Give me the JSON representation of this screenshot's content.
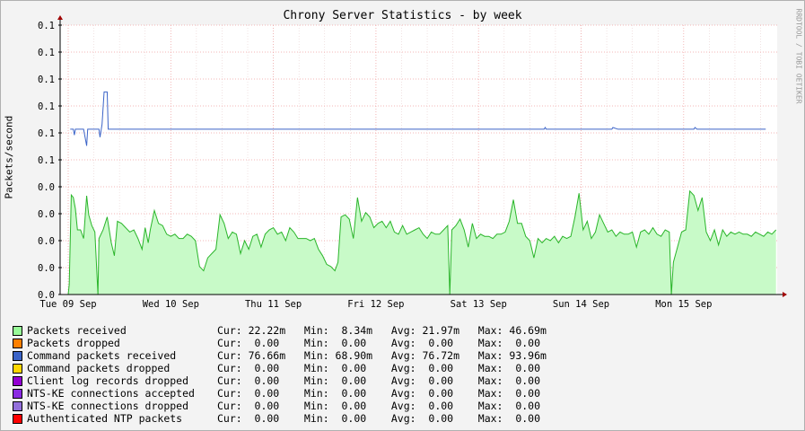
{
  "title": "Chrony Server Statistics - by week",
  "watermark": "RRDTOOL / TOBI OETIKER",
  "chart_data": {
    "type": "area",
    "title": "Chrony Server Statistics - by week",
    "ylabel": "Packets/second",
    "ytick_labels": [
      "0.0",
      "0.0",
      "0.0",
      "0.0",
      "0.0",
      "0.1",
      "0.1",
      "0.1",
      "0.1",
      "0.1",
      "0.1"
    ],
    "ytick_values": [
      0.0,
      0.0125,
      0.025,
      0.0375,
      0.05,
      0.0625,
      0.075,
      0.0875,
      0.1,
      0.1125,
      0.125
    ],
    "ylim": [
      0,
      0.125
    ],
    "xlim_days": [
      0,
      7
    ],
    "xtick_labels": [
      "Tue 09 Sep",
      "Wed 10 Sep",
      "Thu 11 Sep",
      "Fri 12 Sep",
      "Sat 13 Sep",
      "Sun 14 Sep",
      "Mon 15 Sep"
    ],
    "grid": true,
    "series": [
      {
        "name": "Packets received",
        "color": "#98fb98",
        "line_color": "#2ab52a",
        "x_days": [
          -0.28,
          -0.27,
          -0.25,
          -0.23,
          -0.22,
          -0.21,
          -0.2,
          -0.18,
          -0.17,
          -0.16,
          -0.14,
          -0.13,
          -0.12,
          -0.1,
          -0.09,
          -0.08,
          -0.06,
          -0.05,
          -0.04,
          -0.02,
          0.0,
          0.02,
          0.04,
          0.05,
          0.07,
          0.09,
          0.1,
          0.12,
          0.14,
          0.16,
          0.18,
          0.2,
          0.22,
          0.24,
          0.26,
          0.28,
          0.3,
          0.32,
          0.34,
          0.36,
          0.38,
          0.4,
          0.42,
          0.44,
          0.46,
          0.48,
          0.5,
          0.52,
          0.54,
          0.56,
          0.58,
          0.6,
          0.62,
          0.64,
          0.66,
          0.68,
          0.7,
          0.72,
          0.74,
          0.76,
          0.78,
          0.8,
          0.82,
          0.84,
          0.86,
          0.88,
          0.9,
          0.92,
          0.94,
          0.96,
          0.98,
          1.0,
          1.02,
          1.04,
          1.06,
          1.08,
          1.1,
          1.12,
          1.14,
          1.16,
          1.18,
          1.2,
          1.22,
          1.24,
          1.26,
          1.28,
          1.3,
          1.32,
          1.34,
          1.36,
          1.38,
          1.4,
          1.42,
          1.44,
          1.46,
          1.48,
          1.5,
          1.52,
          1.54,
          1.56,
          1.58,
          1.6,
          1.62,
          1.64,
          1.66,
          1.68,
          1.7,
          1.72,
          1.74,
          1.76,
          1.78,
          1.8,
          1.82,
          1.84,
          1.86,
          1.88,
          1.9,
          1.92,
          1.94,
          1.96,
          1.98,
          2.0,
          2.02,
          2.04,
          2.06,
          2.08,
          2.1,
          2.12,
          2.14,
          2.16,
          2.18,
          2.2,
          2.22,
          2.24,
          2.26,
          2.28,
          2.3,
          2.32,
          2.34,
          2.36,
          2.38,
          2.4,
          2.42,
          2.44,
          2.46,
          2.48,
          2.5,
          2.52,
          2.54,
          2.56,
          2.58,
          2.6,
          2.62,
          2.64,
          2.66,
          2.68,
          2.7,
          2.72,
          2.74,
          2.76,
          2.78,
          2.8,
          2.82,
          2.84,
          2.86,
          2.88,
          2.9,
          2.92,
          2.94,
          2.96,
          2.98,
          3.0,
          3.02,
          3.04,
          3.06,
          3.08,
          3.1,
          3.12,
          3.14,
          3.16,
          3.18,
          3.2,
          3.22,
          3.24,
          3.26,
          3.28,
          3.3,
          3.32,
          3.34,
          3.36,
          3.38,
          3.4,
          3.42,
          3.44,
          3.46,
          3.48,
          3.5,
          3.52,
          3.54,
          3.56,
          3.58,
          3.6,
          3.62,
          3.64,
          3.66,
          3.68,
          3.7,
          3.72,
          3.74,
          3.76,
          3.78,
          3.8,
          3.82,
          3.84,
          3.86,
          3.88,
          3.9,
          3.92,
          3.94,
          3.96,
          3.98,
          4.0,
          4.02,
          4.04,
          4.06,
          4.08,
          4.1,
          4.12,
          4.14,
          4.16,
          4.18,
          4.2,
          4.22,
          4.24,
          4.26,
          4.28,
          4.3,
          4.32,
          4.34,
          4.36,
          4.38,
          4.4,
          4.42,
          4.44,
          4.46,
          4.48,
          4.5,
          4.52,
          4.54,
          4.56,
          4.58,
          4.6,
          4.62,
          4.64,
          4.66,
          4.68,
          4.7,
          4.72,
          4.74,
          4.76,
          4.78,
          4.8,
          4.82,
          4.84,
          4.86,
          4.88,
          4.9,
          4.92,
          4.94,
          4.96,
          4.98,
          5.0,
          5.02,
          5.04,
          5.06,
          5.08,
          5.1,
          5.12,
          5.14,
          5.16,
          5.18,
          5.2,
          5.22,
          5.24,
          5.26,
          5.28,
          5.3,
          5.32,
          5.34,
          5.36,
          5.38,
          5.4,
          5.42,
          5.44,
          5.46,
          5.48,
          5.5,
          5.52,
          5.54,
          5.56,
          5.58,
          5.6,
          5.62,
          5.64,
          5.66,
          5.68,
          5.7,
          5.72,
          5.74,
          5.76,
          5.78,
          5.8,
          5.82,
          5.84,
          5.86,
          5.88,
          5.9,
          5.92,
          5.94,
          5.96,
          5.98,
          6.0,
          6.02,
          6.04,
          6.06,
          6.08,
          6.1,
          6.12,
          6.14,
          6.16,
          6.18,
          6.2,
          6.22,
          6.24,
          6.26,
          6.28,
          6.3,
          6.32,
          6.34,
          6.36,
          6.38,
          6.4,
          6.42,
          6.44,
          6.46,
          6.48,
          6.5,
          6.52,
          6.54,
          6.56,
          6.58,
          6.6,
          6.62,
          6.64,
          6.66,
          6.68,
          6.7,
          6.72,
          6.74,
          6.76,
          6.78,
          6.8,
          6.82,
          6.84,
          6.86,
          6.88,
          6.9,
          6.92,
          6.94,
          6.96,
          6.98,
          7.0,
          7.02,
          7.04,
          7.06,
          7.08,
          7.1,
          7.12,
          7.14,
          7.16,
          7.18,
          7.2,
          7.22,
          7.24,
          7.26,
          7.28,
          7.3,
          7.32,
          7.34,
          7.36,
          7.38,
          7.4,
          7.42,
          7.44,
          7.46,
          7.48,
          7.5,
          7.52,
          7.54,
          7.56,
          7.58,
          7.6,
          7.62,
          7.64,
          7.66,
          7.68,
          7.7,
          7.72,
          7.74,
          7.76,
          7.78,
          7.8,
          7.82,
          7.84,
          7.86,
          7.88,
          7.9,
          7.92,
          7.94,
          7.96,
          7.98,
          8.0,
          8.02,
          8.04,
          8.06,
          8.08,
          8.1,
          8.12,
          8.14,
          8.16,
          8.18,
          8.2,
          8.22,
          8.24,
          8.26,
          8.28,
          8.3,
          8.32,
          8.34,
          8.36,
          8.38,
          8.4,
          8.42,
          8.44,
          8.46,
          8.48,
          8.5,
          8.52,
          8.54,
          8.56,
          8.58,
          8.6,
          8.62,
          8.64,
          8.66,
          8.68,
          8.7,
          8.72,
          8.74,
          8.76,
          8.78,
          8.8,
          8.82,
          8.84,
          8.86,
          8.88,
          8.9,
          8.92,
          8.94,
          8.96,
          8.98,
          9.0,
          9.02,
          9.04,
          9.06,
          9.08,
          9.1,
          9.12,
          9.14,
          9.16,
          9.18,
          9.2,
          9.22,
          9.24,
          9.26,
          9.28,
          9.3,
          9.32,
          9.34,
          9.36,
          9.38,
          9.4,
          9.42,
          9.44,
          9.46,
          9.48,
          9.5,
          9.52,
          9.54,
          9.56,
          9.58,
          9.6,
          9.62,
          9.64,
          9.66,
          9.68,
          9.7,
          9.72,
          9.74,
          9.76,
          9.78,
          9.8,
          9.82,
          9.84,
          9.86,
          9.88,
          9.9,
          9.92,
          9.94,
          9.96,
          9.98,
          10.0,
          10.02,
          10.04,
          10.06,
          10.08,
          10.1,
          10.12,
          10.14,
          10.16,
          10.18,
          10.2,
          10.22,
          10.24,
          10.26,
          10.28,
          10.3,
          10.32,
          10.34,
          10.36,
          10.38,
          10.4,
          10.42,
          10.44,
          10.46,
          10.48,
          10.5,
          10.52,
          10.54,
          10.56,
          10.58,
          10.6,
          10.62,
          10.64,
          10.66,
          10.68,
          10.7,
          10.72,
          10.74,
          10.76,
          10.78,
          10.8,
          10.82,
          10.84,
          10.86,
          10.88,
          10.9,
          10.92,
          10.94,
          10.96,
          10.98,
          11.0,
          11.02,
          11.04,
          11.06,
          11.08,
          11.1,
          11.12,
          11.14,
          11.16,
          11.18,
          11.2,
          11.22,
          11.24,
          11.26,
          11.28,
          11.3,
          11.32,
          11.34,
          11.36,
          11.38,
          11.4,
          11.42,
          11.44,
          11.46,
          11.48,
          11.5,
          11.52,
          11.54,
          11.56,
          11.58,
          11.6,
          11.62,
          11.64,
          11.66,
          11.68,
          11.7,
          11.72,
          11.74,
          11.76,
          11.78,
          11.8,
          11.82,
          11.84,
          11.86,
          11.88,
          11.9,
          11.92,
          11.94,
          11.96,
          11.98,
          12.0,
          12.02,
          12.04,
          12.06,
          12.08,
          12.1,
          12.12,
          12.14,
          12.16,
          12.18,
          12.2,
          12.22,
          12.24,
          12.26,
          12.28,
          12.3,
          12.32,
          12.34,
          12.36,
          12.38,
          12.4,
          12.42,
          12.44,
          12.46,
          12.48,
          12.5,
          12.52,
          12.54,
          12.56,
          12.58,
          12.6,
          12.62,
          12.64,
          12.66,
          12.68,
          12.7,
          12.72,
          12.74,
          12.76,
          12.78,
          12.8,
          12.82,
          12.84,
          12.86,
          12.88,
          12.9,
          12.92,
          12.94,
          12.96,
          12.98,
          13.0,
          13.02,
          13.04,
          13.06,
          13.08,
          13.1,
          13.12,
          13.14,
          13.16,
          13.18,
          13.2,
          13.22,
          13.24,
          13.26,
          13.28,
          13.3,
          13.32,
          13.34,
          13.36,
          13.38,
          13.4,
          13.42,
          13.44,
          13.46,
          13.48,
          13.5,
          13.52,
          13.54,
          13.56,
          13.58,
          13.6,
          13.62,
          13.64,
          13.66,
          13.68,
          13.7,
          13.72,
          13.74,
          13.76,
          13.78,
          13.8,
          13.82,
          13.84,
          13.86,
          13.88,
          13.9,
          13.92,
          13.94,
          13.96,
          13.98,
          14.0,
          14.02,
          14.04,
          14.06,
          14.08,
          14.1,
          14.12,
          14.14,
          14.16,
          14.18,
          14.2,
          14.22,
          14.24,
          14.26,
          14.28,
          14.3,
          14.32,
          14.34,
          14.36,
          14.38,
          14.4,
          14.42,
          14.44,
          14.46,
          14.48,
          14.5,
          14.52,
          14.54,
          14.56,
          14.58,
          14.6,
          14.62,
          14.64,
          14.66,
          14.68,
          14.7,
          14.72,
          14.74,
          14.76,
          14.78,
          14.8,
          14.82,
          14.84,
          14.86,
          14.88,
          14.9,
          14.92,
          14.94,
          14.96,
          14.98,
          15.0,
          15.02,
          15.04,
          15.06,
          15.08,
          15.1,
          15.12,
          15.14,
          15.16,
          15.18,
          15.2,
          15.22,
          15.24,
          15.26,
          15.28,
          15.3,
          15.32,
          15.34,
          15.36,
          15.38,
          15.4,
          15.42,
          15.44,
          15.46,
          15.48,
          15.5,
          15.52,
          15.54,
          15.56,
          15.58,
          15.6,
          15.62,
          15.64,
          15.66,
          15.68,
          15.7,
          15.72,
          15.74,
          15.76,
          15.78,
          15.8,
          15.82,
          15.84,
          15.86,
          15.88,
          15.9,
          15.92,
          15.94,
          15.96,
          15.98,
          16.0,
          16.02,
          16.04,
          16.06,
          16.08,
          16.1,
          16.12,
          16.14,
          16.16,
          16.18,
          16.2,
          16.22,
          16.24,
          16.26,
          16.28,
          16.3,
          16.32,
          16.34,
          16.36,
          16.38,
          16.4,
          16.42,
          16.44,
          16.46,
          16.48,
          16.5,
          16.52,
          16.54,
          16.56,
          16.58,
          16.6,
          16.62,
          16.64,
          16.66,
          16.68,
          16.7,
          16.72,
          16.74,
          16.76,
          16.78,
          16.8,
          16.82,
          16.84,
          16.86,
          16.88,
          16.9,
          16.92,
          16.94,
          16.96,
          16.98,
          17.0,
          17.02,
          17.04,
          17.06,
          17.08,
          17.1,
          17.12,
          17.14,
          17.16,
          17.18,
          17.2,
          17.22,
          17.24,
          17.26,
          17.28,
          17.3,
          17.32,
          17.34,
          17.36,
          17.38,
          17.4,
          17.42,
          17.44,
          17.46,
          17.48,
          17.5,
          17.52,
          17.54,
          17.56,
          17.58,
          17.6,
          17.62,
          17.64,
          17.66,
          17.68,
          17.7,
          17.72,
          17.74,
          17.76,
          17.78,
          17.8,
          17.82,
          17.84,
          17.86,
          17.88,
          17.9,
          17.92,
          17.94,
          17.96,
          17.98,
          18.0,
          18.02,
          18.04,
          18.06,
          18.08,
          18.1,
          18.12,
          18.14,
          18.16,
          18.18,
          18.2,
          18.22,
          18.24,
          18.26,
          18.28,
          18.3,
          18.32,
          18.34,
          18.36,
          18.38,
          18.4,
          18.42,
          18.44,
          18.46,
          18.48,
          18.5,
          18.52,
          18.54,
          18.56,
          18.58,
          18.6,
          18.62,
          18.64,
          18.66,
          18.68,
          18.7,
          18.72,
          18.74,
          18.76,
          18.78,
          18.8,
          18.82,
          18.84,
          18.86,
          18.88,
          18.9,
          18.92,
          18.94,
          18.96,
          18.98,
          19.0,
          19.02,
          19.04,
          19.06,
          19.08,
          19.1,
          19.12,
          19.14,
          19.16,
          19.18,
          19.2,
          19.22,
          19.24,
          19.26,
          19.28,
          19.3,
          19.32,
          19.34,
          19.36,
          19.38,
          19.4,
          19.42,
          19.44,
          19.46,
          19.48,
          19.5,
          19.52,
          19.54,
          19.56,
          19.58,
          19.6,
          19.62,
          19.64,
          19.66,
          19.68,
          19.7,
          19.72,
          19.74,
          19.76,
          19.78,
          19.8,
          19.82,
          19.84,
          19.86,
          19.88,
          19.9,
          19.92,
          19.94,
          19.96,
          19.98,
          20.0
        ],
        "values_placeholder": true
      },
      {
        "name": "Packets dropped",
        "color": "#ff8000",
        "cur": "0.00",
        "min": "0.00",
        "avg": "0.00",
        "max": "0.00"
      },
      {
        "name": "Command packets received",
        "color": "#3c64c8"
      },
      {
        "name": "Command packets dropped",
        "color": "#ffd700"
      },
      {
        "name": "Client log records dropped",
        "color": "#9400d3"
      },
      {
        "name": "NTS-KE connections accepted",
        "color": "#8a2be2"
      },
      {
        "name": "NTS-KE connections dropped",
        "color": "#9370db"
      },
      {
        "name": "Authenticated NTP packets",
        "color": "#ff0000"
      }
    ]
  },
  "legend": [
    {
      "name": "Packets received",
      "color": "#98fb98",
      "stats": "Cur: 22.22m   Min:  8.34m   Avg: 21.97m   Max: 46.69m"
    },
    {
      "name": "Packets dropped",
      "color": "#ff8000",
      "stats": "Cur:  0.00    Min:  0.00    Avg:  0.00    Max:  0.00 "
    },
    {
      "name": "Command packets received",
      "color": "#3c64c8",
      "stats": "Cur: 76.66m   Min: 68.90m   Avg: 76.72m   Max: 93.96m"
    },
    {
      "name": "Command packets dropped",
      "color": "#ffd700",
      "stats": "Cur:  0.00    Min:  0.00    Avg:  0.00    Max:  0.00 "
    },
    {
      "name": "Client log records dropped",
      "color": "#9400d3",
      "stats": "Cur:  0.00    Min:  0.00    Avg:  0.00    Max:  0.00 "
    },
    {
      "name": "NTS-KE connections accepted",
      "color": "#8a2be2",
      "stats": "Cur:  0.00    Min:  0.00    Avg:  0.00    Max:  0.00 "
    },
    {
      "name": "NTS-KE connections dropped",
      "color": "#9370db",
      "stats": "Cur:  0.00    Min:  0.00    Avg:  0.00    Max:  0.00 "
    },
    {
      "name": "Authenticated NTP packets",
      "color": "#ff0000",
      "stats": "Cur:  0.00    Min:  0.00    Avg:  0.00    Max:  0.00 "
    }
  ]
}
